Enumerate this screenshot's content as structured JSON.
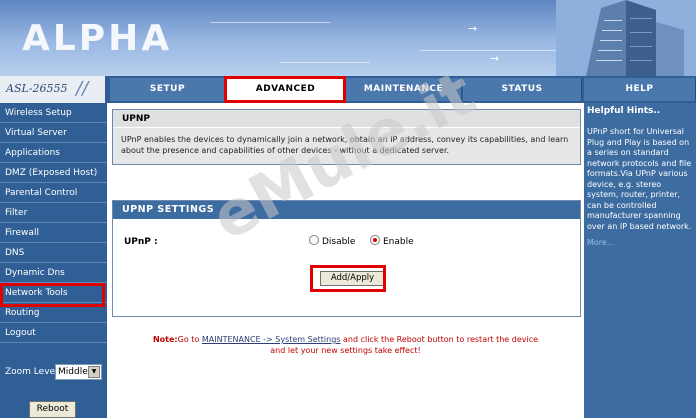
{
  "brand": {
    "logo": "ALPHA"
  },
  "model": {
    "label": "ASL-26555"
  },
  "tabs": [
    {
      "label": "SETUP",
      "active": false
    },
    {
      "label": "ADVANCED",
      "active": true
    },
    {
      "label": "MAINTENANCE",
      "active": false
    },
    {
      "label": "STATUS",
      "active": false
    },
    {
      "label": "HELP",
      "active": false
    }
  ],
  "sidebar": {
    "items": [
      {
        "label": "Wireless Setup"
      },
      {
        "label": "Virtual Server"
      },
      {
        "label": "Applications"
      },
      {
        "label": "DMZ (Exposed Host)"
      },
      {
        "label": "Parental Control"
      },
      {
        "label": "Filter"
      },
      {
        "label": "Firewall"
      },
      {
        "label": "DNS"
      },
      {
        "label": "Dynamic Dns"
      },
      {
        "label": "Network Tools",
        "highlighted": true
      },
      {
        "label": "Routing"
      },
      {
        "label": "Logout"
      }
    ],
    "zoom_label": "Zoom Level:",
    "zoom_value": "Middle",
    "reboot_label": "Reboot"
  },
  "upnp": {
    "title": "UPNP",
    "description": "UPnP enables the devices to dynamically join a network, obtain an IP address, convey its capabilities, and learn about the presence and capabilities of other devices - without a dedicated server."
  },
  "settings": {
    "title": "UPNP SETTINGS",
    "upnp_label": "UPnP :",
    "option_disable": "Disable",
    "option_enable": "Enable",
    "selected": "Enable",
    "apply_label": "Add/Apply"
  },
  "note": {
    "label": "Note:",
    "text_before": "Go to ",
    "link": "MAINTENANCE -> System Settings",
    "text_after": " and click the Reboot button to restart the device",
    "line2": "and let your new settings take effect!"
  },
  "hints": {
    "title": "Helpful Hints..",
    "text": "UPnP short for Universal Plug and Play is based on a series on standard network protocols and file formats.Via UPnP various device, e.g. stereo system, router, printer, can be controlled manufacturer spanning over an IP based network.",
    "more": "More..."
  },
  "watermark": "eMule.it",
  "colors": {
    "nav_blue": "#2f5f95",
    "panel_blue": "#3d6ca1",
    "highlight_red": "#e00000"
  }
}
